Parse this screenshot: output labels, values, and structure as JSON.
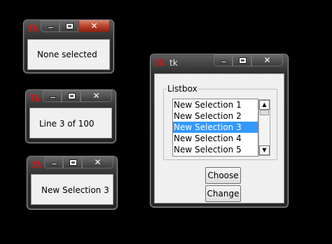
{
  "windows": {
    "top_left": {
      "label": "None selected"
    },
    "middle_left": {
      "label": "Line 3 of 100"
    },
    "bottom_left": {
      "label": "New Selection 3"
    },
    "main": {
      "title": "tk",
      "groupbox_label": "Listbox",
      "items": [
        "New Selection 1",
        "New Selection 2",
        "New Selection 3",
        "New Selection 4",
        "New Selection 5"
      ],
      "selected_index": 2,
      "choose_label": "Choose",
      "change_label": "Change"
    }
  },
  "caption_buttons": {
    "close_glyph": "✕"
  },
  "logo_text": "Tk",
  "colors": {
    "selection": "#3399ff",
    "close_red": "#b6412a",
    "logo_red": "#d41414"
  }
}
